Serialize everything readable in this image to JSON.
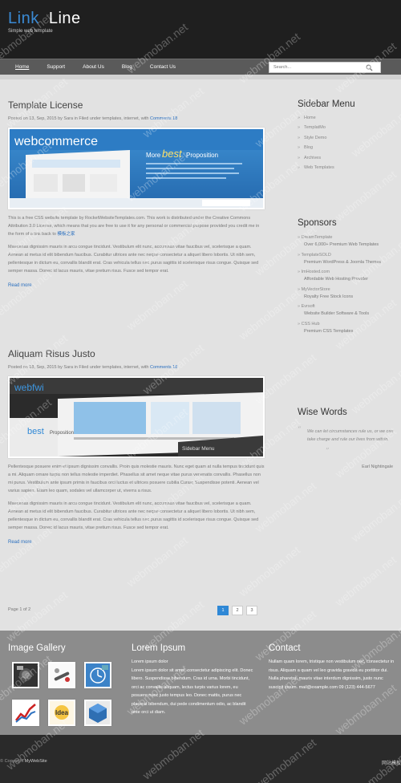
{
  "header": {
    "logo_word1": "Link",
    "logo_word2": "Line",
    "slogan": "Simple web template"
  },
  "menu": {
    "items": [
      {
        "label": "Home",
        "active": true
      },
      {
        "label": "Support"
      },
      {
        "label": "About Us"
      },
      {
        "label": "Blog"
      },
      {
        "label": "Contact Us"
      }
    ],
    "search_placeholder": "Search..."
  },
  "posts": [
    {
      "title": "Template License",
      "meta_prefix": "Posted on 13, Sep, 2015 by Sara in Filed under templates, internet, with ",
      "comments_link": "Comments 18",
      "banner_text_1": "webcommerce",
      "banner_text_2": "More",
      "banner_text_3": "best",
      "banner_text_4": "Proposition",
      "para1_text": "This is a free CSS website template by RocketWebsiteTemplates.com. This work is distributed under the Creative Commons Attribution 3.0 License, which means that you are free to use it for any personal or commercial purpose provided you credit me in the form of a link back to ",
      "para1_link": "模板之家",
      "para2": "Maecenas dignissim mauris in arcu congue tincidunt. Vestibulum elit nunc, accumsan vitae faucibus vel, scelerisque a quam. Aenean at metus id elit bibendum faucibus. Curabitur ultrices ante nec neque consectetur a aliquet libero lobortis. Ut nibh sem, pellentesque in dictum eu, convallis blandit erat. Cras vehicula tellus nec purus sagittis id scelerisque risus congue. Quisque sed semper massa. Donec id lacus mauris, vitae pretium risus. Fusce sed tempor erat.",
      "read_more": "Read more"
    },
    {
      "title": "Aliquam Risus Justo",
      "meta_prefix": "Posted on 18, Sep, 2015 by Sara in Filed under templates, internet, with ",
      "comments_link": "Comments 18",
      "banner_text_1": "webfwi",
      "banner_text_2": "best",
      "banner_text_3": "Proposition",
      "banner_text_4": "Sidebar Menu",
      "para1_text": "Pellentesque posuere enim et ipsum dignissim convallis. Proin quis molestie mauris. Nunc eget quam at nulla tempus tincidunt quis a mi. Aliquam ornare turpis non tellus molestie imperdiet. Phasellus sit amet neque vitae purus venenatis convallis. Phasellus non mi purus. Vestibulum ante ipsum primis in faucibus orci luctus et ultrices posuere cubilia Curae; Suspendisse potenti. Aenean vel varius sapien. Etiam leo quam, sodales vel ullamcorper ut, viverra a risus.",
      "para1_link": "",
      "para2": "Maecenas dignissim mauris in arcu congue tincidunt. Vestibulum elit nunc, accumsan vitae faucibus vel, scelerisque a quam. Aenean at metus id elit bibendum faucibus. Curabitur ultrices ante nec neque consectetur a aliquet libero lobortis. Ut nibh sem, pellentesque in dictum eu, convallis blandit erat. Cras vehicula tellus nec purus sagittis id scelerisque risus congue. Quisque sed semper massa. Donec id lacus mauris, vitae pretium risus. Fusce sed tempor erat.",
      "read_more": "Read more"
    }
  ],
  "pagination": {
    "text": "Page 1 of 2",
    "pages": [
      "1",
      "2",
      "3"
    ],
    "current": "1"
  },
  "sidebar": {
    "menu_title": "Sidebar Menu",
    "menu_items": [
      "Home",
      "TemplatMo",
      "Style Demo",
      "Blog",
      "Archives",
      "Web Templates"
    ],
    "sponsors_title": "Sponsors",
    "sponsors": [
      {
        "name": "DreamTemplate",
        "desc": "Over 6,000+ Premium Web Templates"
      },
      {
        "name": "TemplateSOLD",
        "desc": "Premium WordPress & Joomla Themes"
      },
      {
        "name": "ImHosted.com",
        "desc": "Affordable Web Hosting Provider"
      },
      {
        "name": "MyVectorStore",
        "desc": "Royalty Free Stock Icons"
      },
      {
        "name": "Evrsoft",
        "desc": "Website Builder Software & Tools"
      },
      {
        "name": "CSS Hub",
        "desc": "Premium CSS Templates"
      }
    ],
    "wise_title": "Wise Words",
    "quote": "We can let circumstances rule us, or we can take charge and rule our lives from within.",
    "quote_author": "Earl Nightingale"
  },
  "footer": {
    "gallery_title": "Image Gallery",
    "lorem_title": "Lorem Ipsum",
    "lorem_lead": "Lorem ipsum dolor",
    "lorem_text": "Lorem ipsum dolor sit amet, consectetur adipiscing elit. Donec libero. Suspendisse bibendum. Cras id urna. Morbi tincidunt, orci ac convallis aliquam, lectus turpis varius lorem, eu posuere nunc justo tempus leo. Donec mattis, purus nec placerat bibendum, dui pede condimentum odio, ac blandit ante orci ut diam.",
    "contact_title": "Contact",
    "contact_text": "Nullam quam lorem, tristique non vestibulum nec, consectetur in risus. Aliquam a quam vel leo gravida gravida eu porttitor dui. Nulla pharetra, mauris vitae interdum dignissim, justo nunc suscipit ipsum. mail@example.com 09 (123) 444-5677",
    "copyright_prefix": "© Copyright ",
    "copyright_link": "MyWebSite",
    "credit": "网站模板"
  },
  "watermark": "webmoban.net",
  "colors": {
    "header_bg": "#1f1f1f",
    "menu_bg": "#5a5a5a",
    "accent": "#2f88d6",
    "footer_bg": "#8c8c8c"
  }
}
